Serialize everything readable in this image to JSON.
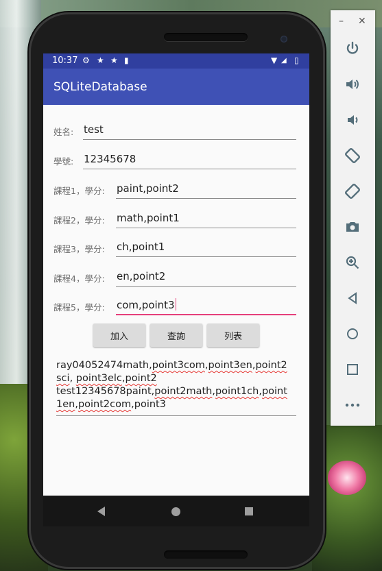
{
  "status_bar": {
    "time": "10:37"
  },
  "app": {
    "title": "SQLiteDatabase"
  },
  "form": {
    "name": {
      "label": "姓名:",
      "value": "test"
    },
    "student_id": {
      "label": "學號:",
      "value": "12345678"
    },
    "courses": [
      {
        "label": "課程1，學分:",
        "value": "paint,point2"
      },
      {
        "label": "課程2，學分:",
        "value": "math,point1"
      },
      {
        "label": "課程3，學分:",
        "value": "ch,point1"
      },
      {
        "label": "課程4，學分:",
        "value": "en,point2"
      },
      {
        "label": "課程5，學分:",
        "value": "com,point3"
      }
    ]
  },
  "buttons": {
    "add": "加入",
    "query": "查詢",
    "list": "列表"
  },
  "result_lines": {
    "l1a": "ray04052474math,",
    "l1b": "point3com",
    "l1c": ",",
    "l1d": "point3en",
    "l1e": ",",
    "l1f": "point2",
    "l2a": "sci",
    "l2b": ", ",
    "l2c": "point3elc",
    "l2d": ",",
    "l2e": "point2",
    "l3a": "test12345678paint,",
    "l3b": "point2math",
    "l3c": ",",
    "l3d": "point1ch",
    "l3e": ",",
    "l3f": "point",
    "l4a": "1en",
    "l4b": ",",
    "l4c": "point2com",
    "l4d": ",point3"
  },
  "emulator_panel": {
    "minimize": "–",
    "close": "✕",
    "icons": [
      "power-icon",
      "volume-up-icon",
      "volume-down-icon",
      "rotate-left-icon",
      "rotate-right-icon",
      "camera-icon",
      "zoom-icon",
      "back-icon",
      "home-icon",
      "overview-icon",
      "more-icon"
    ]
  },
  "colors": {
    "primary": "#3f51b5",
    "primary_dark": "#303f9f",
    "accent": "#e53f7b"
  }
}
